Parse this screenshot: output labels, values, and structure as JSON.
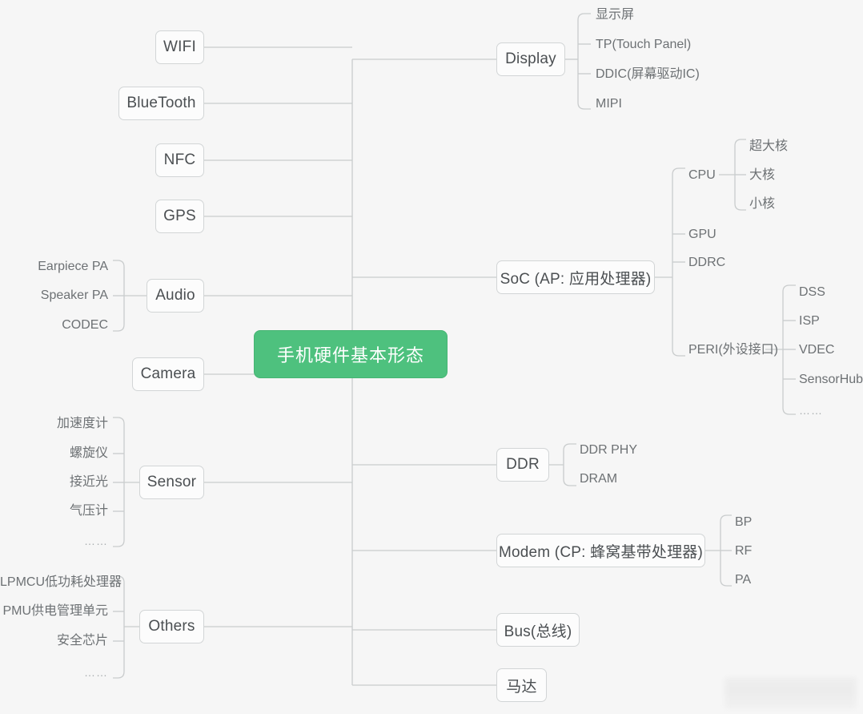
{
  "diagram": {
    "title": "手机硬件基本形态",
    "colors": {
      "root_fill": "#4ec17e",
      "root_text": "#ffffff",
      "node_fill": "#fcfcfc",
      "node_border": "#d2d5d6",
      "wire": "#c9cccd",
      "background": "#f6f6f6",
      "text": "#4b4f52",
      "leaf_text": "#6d7174"
    },
    "left_branches": [
      {
        "label": "WIFI",
        "children": []
      },
      {
        "label": "BlueTooth",
        "children": []
      },
      {
        "label": "NFC",
        "children": []
      },
      {
        "label": "GPS",
        "children": []
      },
      {
        "label": "Audio",
        "children": [
          "Earpiece PA",
          "Speaker PA",
          "CODEC"
        ]
      },
      {
        "label": "Camera",
        "children": []
      },
      {
        "label": "Sensor",
        "children": [
          "加速度计",
          "螺旋仪",
          "接近光",
          "气压计",
          "……"
        ]
      },
      {
        "label": "Others",
        "children": [
          "LPMCU低功耗处理器",
          "PMU供电管理单元",
          "安全芯片",
          "……"
        ]
      }
    ],
    "right_branches": [
      {
        "label": "Display",
        "children": [
          "显示屏",
          "TP(Touch Panel)",
          "DDIC(屏幕驱动IC)",
          "MIPI"
        ]
      },
      {
        "label": "SoC (AP: 应用处理器)",
        "children": [
          {
            "label": "CPU",
            "children": [
              "超大核",
              "大核",
              "小核"
            ]
          },
          {
            "label": "GPU",
            "children": []
          },
          {
            "label": "DDRC",
            "children": []
          },
          {
            "label": "PERI(外设接口)",
            "children": [
              "DSS",
              "ISP",
              "VDEC",
              "SensorHub",
              "……"
            ]
          }
        ]
      },
      {
        "label": "DDR",
        "children": [
          "DDR PHY",
          "DRAM"
        ]
      },
      {
        "label": "Modem (CP: 蜂窝基带处理器)",
        "children": [
          "BP",
          "RF",
          "PA"
        ]
      },
      {
        "label": "Bus(总线)",
        "children": []
      },
      {
        "label": "马达",
        "children": []
      }
    ]
  }
}
